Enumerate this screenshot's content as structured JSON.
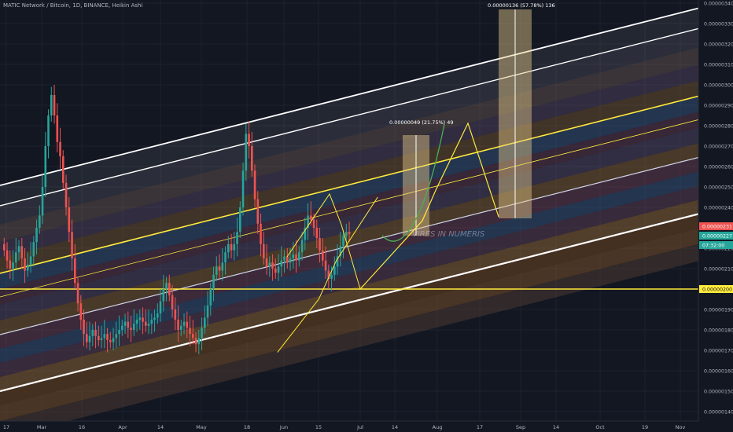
{
  "header": {
    "symbol": "MATIC Network / Bitcoin",
    "interval": "1D",
    "exchange": "BINANCE",
    "chart_style": "Heikin Ashi"
  },
  "colors": {
    "background": "#131722",
    "up_candle": "#26a69a",
    "down_candle": "#ef5350",
    "support_line": "#ffeb3b",
    "bid_tag": "#ef5350",
    "ask_tag": "#26a69a",
    "axis_text": "#b2b5be"
  },
  "watermark": "VIRES IN NUMERIS",
  "measures": [
    {
      "label": "0.00000049 (21.75%) 49"
    },
    {
      "label": "0.00000136 (57.78%) 136"
    }
  ],
  "price_tags": [
    {
      "value": "0.00000231",
      "kind": "bid"
    },
    {
      "value": "0.00000227",
      "kind": "last"
    },
    {
      "value": "07:32:00",
      "kind": "countdown"
    },
    {
      "value": "0.00000200",
      "kind": "support"
    }
  ],
  "chart_data": {
    "type": "candlestick",
    "series_style": "Heikin Ashi",
    "y_ticks": [
      "0.00000340",
      "0.00000330",
      "0.00000320",
      "0.00000310",
      "0.00000300",
      "0.00000290",
      "0.00000280",
      "0.00000270",
      "0.00000260",
      "0.00000250",
      "0.00000240",
      "0.00000230",
      "0.00000220",
      "0.00000210",
      "0.00000200",
      "0.00000190",
      "0.00000180",
      "0.00000170",
      "0.00000160",
      "0.00000150",
      "0.00000140"
    ],
    "y_tick_values": [
      340,
      330,
      320,
      310,
      300,
      290,
      280,
      270,
      260,
      250,
      240,
      230,
      220,
      210,
      200,
      190,
      180,
      170,
      160,
      150,
      140
    ],
    "y_unit_scale": "1e-8 BTC",
    "x_ticks": [
      "17",
      "Mar",
      "16",
      "Apr",
      "14",
      "May",
      "18",
      "Jun",
      "15",
      "Jul",
      "14",
      "Aug",
      "17",
      "Sep",
      "14",
      "Oct",
      "19",
      "Nov"
    ],
    "support_level": 200,
    "candles": [
      {
        "o": 222,
        "c": 219
      },
      {
        "o": 219,
        "c": 214
      },
      {
        "o": 214,
        "c": 210
      },
      {
        "o": 210,
        "c": 213
      },
      {
        "o": 213,
        "c": 218
      },
      {
        "o": 218,
        "c": 221
      },
      {
        "o": 221,
        "c": 215
      },
      {
        "o": 215,
        "c": 209
      },
      {
        "o": 209,
        "c": 212
      },
      {
        "o": 212,
        "c": 216
      },
      {
        "o": 216,
        "c": 223
      },
      {
        "o": 223,
        "c": 230
      },
      {
        "o": 230,
        "c": 236
      },
      {
        "o": 236,
        "c": 250
      },
      {
        "o": 250,
        "c": 270
      },
      {
        "o": 270,
        "c": 285
      },
      {
        "o": 285,
        "c": 295
      },
      {
        "o": 295,
        "c": 285
      },
      {
        "o": 285,
        "c": 272
      },
      {
        "o": 272,
        "c": 265
      },
      {
        "o": 265,
        "c": 252
      },
      {
        "o": 252,
        "c": 240
      },
      {
        "o": 240,
        "c": 228
      },
      {
        "o": 228,
        "c": 215
      },
      {
        "o": 215,
        "c": 203
      },
      {
        "o": 203,
        "c": 193
      },
      {
        "o": 193,
        "c": 185
      },
      {
        "o": 185,
        "c": 178
      },
      {
        "o": 178,
        "c": 174
      },
      {
        "o": 174,
        "c": 177
      },
      {
        "o": 177,
        "c": 180
      },
      {
        "o": 180,
        "c": 177
      },
      {
        "o": 177,
        "c": 175
      },
      {
        "o": 175,
        "c": 176
      },
      {
        "o": 176,
        "c": 178
      },
      {
        "o": 178,
        "c": 175
      },
      {
        "o": 175,
        "c": 174
      },
      {
        "o": 174,
        "c": 176
      },
      {
        "o": 176,
        "c": 178
      },
      {
        "o": 178,
        "c": 180
      },
      {
        "o": 180,
        "c": 182
      },
      {
        "o": 182,
        "c": 184
      },
      {
        "o": 184,
        "c": 181
      },
      {
        "o": 181,
        "c": 180
      },
      {
        "o": 180,
        "c": 183
      },
      {
        "o": 183,
        "c": 185
      },
      {
        "o": 185,
        "c": 186
      },
      {
        "o": 186,
        "c": 184
      },
      {
        "o": 184,
        "c": 182
      },
      {
        "o": 182,
        "c": 183
      },
      {
        "o": 183,
        "c": 185
      },
      {
        "o": 185,
        "c": 186
      },
      {
        "o": 186,
        "c": 188
      },
      {
        "o": 188,
        "c": 194
      },
      {
        "o": 194,
        "c": 200
      },
      {
        "o": 200,
        "c": 203
      },
      {
        "o": 203,
        "c": 197
      },
      {
        "o": 197,
        "c": 190
      },
      {
        "o": 190,
        "c": 185
      },
      {
        "o": 185,
        "c": 180
      },
      {
        "o": 180,
        "c": 182
      },
      {
        "o": 182,
        "c": 184
      },
      {
        "o": 184,
        "c": 181
      },
      {
        "o": 181,
        "c": 178
      },
      {
        "o": 178,
        "c": 176
      },
      {
        "o": 176,
        "c": 173
      },
      {
        "o": 173,
        "c": 176
      },
      {
        "o": 176,
        "c": 181
      },
      {
        "o": 181,
        "c": 186
      },
      {
        "o": 186,
        "c": 192
      },
      {
        "o": 192,
        "c": 200
      },
      {
        "o": 200,
        "c": 207
      },
      {
        "o": 207,
        "c": 211
      },
      {
        "o": 211,
        "c": 209
      },
      {
        "o": 209,
        "c": 213
      },
      {
        "o": 213,
        "c": 218
      },
      {
        "o": 218,
        "c": 222
      },
      {
        "o": 222,
        "c": 219
      },
      {
        "o": 219,
        "c": 222
      },
      {
        "o": 222,
        "c": 228
      },
      {
        "o": 228,
        "c": 240
      },
      {
        "o": 240,
        "c": 258
      },
      {
        "o": 258,
        "c": 276
      },
      {
        "o": 276,
        "c": 270
      },
      {
        "o": 270,
        "c": 258
      },
      {
        "o": 258,
        "c": 244
      },
      {
        "o": 244,
        "c": 232
      },
      {
        "o": 232,
        "c": 222
      },
      {
        "o": 222,
        "c": 215
      },
      {
        "o": 215,
        "c": 211
      },
      {
        "o": 211,
        "c": 213
      },
      {
        "o": 213,
        "c": 210
      },
      {
        "o": 210,
        "c": 208
      },
      {
        "o": 208,
        "c": 211
      },
      {
        "o": 211,
        "c": 214
      },
      {
        "o": 214,
        "c": 216
      },
      {
        "o": 216,
        "c": 213
      },
      {
        "o": 213,
        "c": 215
      },
      {
        "o": 215,
        "c": 217
      },
      {
        "o": 217,
        "c": 214
      },
      {
        "o": 214,
        "c": 218
      },
      {
        "o": 218,
        "c": 224
      },
      {
        "o": 224,
        "c": 230
      },
      {
        "o": 230,
        "c": 236
      },
      {
        "o": 236,
        "c": 234
      },
      {
        "o": 234,
        "c": 230
      },
      {
        "o": 230,
        "c": 225
      },
      {
        "o": 225,
        "c": 219
      },
      {
        "o": 219,
        "c": 214
      },
      {
        "o": 214,
        "c": 209
      },
      {
        "o": 209,
        "c": 205
      },
      {
        "o": 205,
        "c": 207
      },
      {
        "o": 207,
        "c": 211
      },
      {
        "o": 211,
        "c": 216
      },
      {
        "o": 216,
        "c": 221
      },
      {
        "o": 221,
        "c": 226
      },
      {
        "o": 226,
        "c": 228
      },
      {
        "o": 228,
        "c": 227
      }
    ],
    "projection": [
      {
        "i": 108,
        "v": 205
      },
      {
        "i": 118,
        "v": 228
      },
      {
        "i": 127,
        "v": 260
      },
      {
        "i": 132,
        "v": 280
      },
      {
        "i": 136,
        "v": 283
      },
      {
        "i": 145,
        "v": 270
      },
      {
        "i": 152,
        "v": 237
      }
    ],
    "drawn_path": [
      {
        "i": 93,
        "v": 169
      },
      {
        "i": 107,
        "v": 195
      },
      {
        "i": 113,
        "v": 214
      },
      {
        "i": 127,
        "v": 245
      }
    ]
  }
}
